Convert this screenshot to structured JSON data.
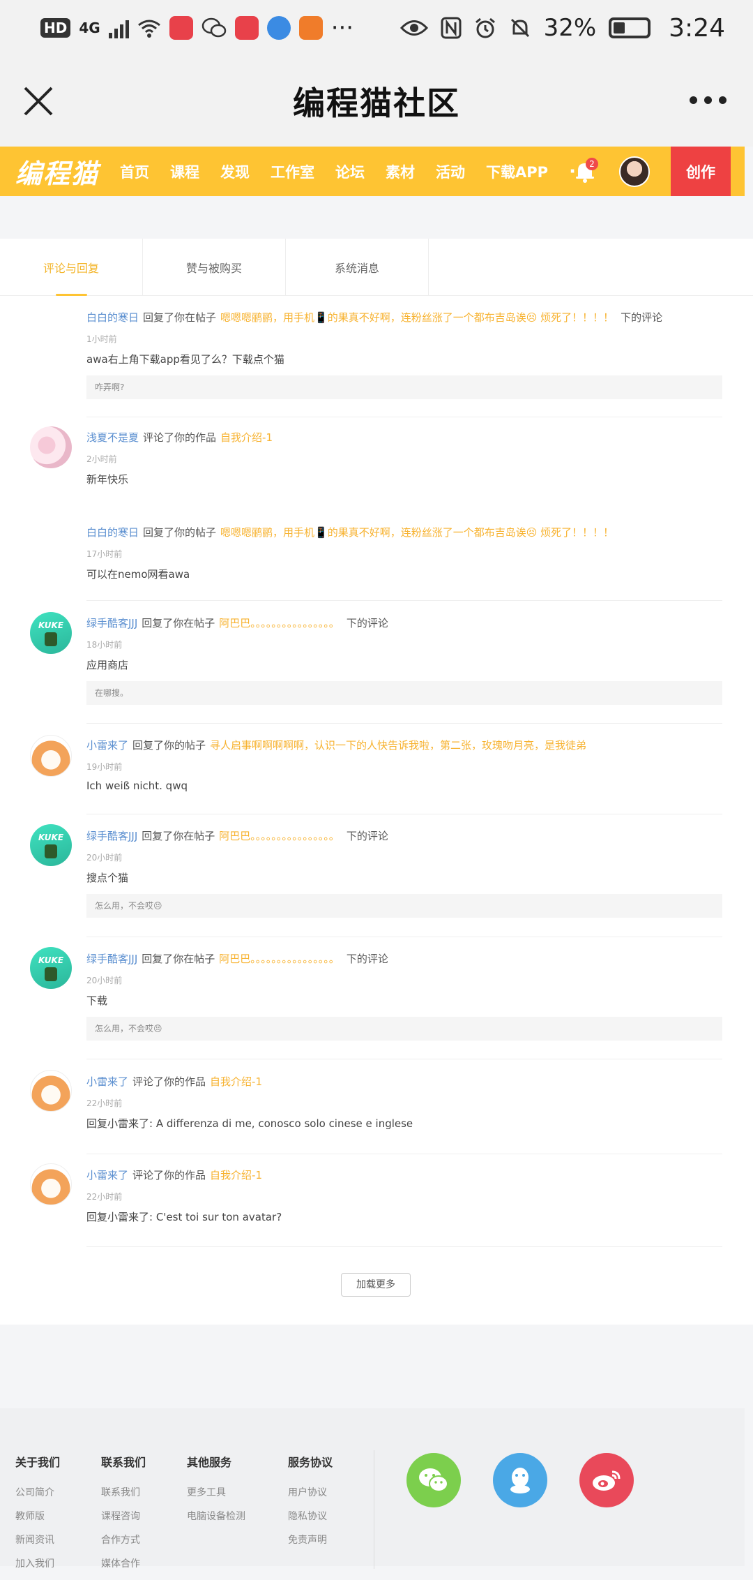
{
  "status_bar": {
    "hd": "HD",
    "net": "4G",
    "more": "···",
    "battery": "32%",
    "time": "3:24"
  },
  "titlebar": {
    "title": "编程猫社区"
  },
  "sitenav": {
    "logo": "编程猫",
    "items": [
      "首页",
      "课程",
      "发现",
      "工作室",
      "论坛",
      "素材",
      "活动",
      "下载APP"
    ],
    "more": "···",
    "notification_count": "2",
    "create_label": "创作"
  },
  "tabs": [
    {
      "label": "评论与回复",
      "active": true
    },
    {
      "label": "赞与被购买",
      "active": false
    },
    {
      "label": "系统消息",
      "active": false
    }
  ],
  "messages": [
    {
      "avatar": "none",
      "user": "白白的寒日",
      "action": "回复了你在帖子",
      "ref": "嗯嗯嗯鹂鹂，用手机📱的果真不好啊，连粉丝涨了一个都布吉岛诶😣 烦死了！！！！",
      "tail": "下的评论",
      "time": "1小时前",
      "body": "awa右上角下载app看见了么？下载点个猫",
      "quote": "咋弄啊?"
    },
    {
      "avatar": "flower",
      "user": "浅夏不是夏",
      "action": "评论了你的作品",
      "ref": "自我介绍-1",
      "tail": "",
      "time": "2小时前",
      "body": "新年快乐",
      "quote": ""
    },
    {
      "avatar": "none",
      "user": "白白的寒日",
      "action": "回复了你的帖子",
      "ref": "嗯嗯嗯鹂鹂，用手机📱的果真不好啊，连粉丝涨了一个都布吉岛诶😣 烦死了！！！！",
      "tail": "",
      "time": "17小时前",
      "body": "可以在nemo网看awa",
      "quote": ""
    },
    {
      "avatar": "kuke",
      "user": "绿手酷客JJJ",
      "action": "回复了你在帖子",
      "ref": "阿巴巴。。。。。。。。。。。。。。。。",
      "tail": "下的评论",
      "time": "18小时前",
      "body": "应用商店",
      "quote": "在哪搜。"
    },
    {
      "avatar": "shiba",
      "user": "小雷来了",
      "action": "回复了你的帖子",
      "ref": "寻人启事啊啊啊啊啊，认识一下的人快告诉我啦，第二张，玫瑰吻月亮，是我徒弟",
      "tail": "",
      "time": "19小时前",
      "body": "Ich weiß nicht. qwq",
      "quote": ""
    },
    {
      "avatar": "kuke",
      "user": "绿手酷客JJJ",
      "action": "回复了你在帖子",
      "ref": "阿巴巴。。。。。。。。。。。。。。。。",
      "tail": "下的评论",
      "time": "20小时前",
      "body": "搜点个猫",
      "quote": "怎么用，不会哎😣"
    },
    {
      "avatar": "kuke",
      "user": "绿手酷客JJJ",
      "action": "回复了你在帖子",
      "ref": "阿巴巴。。。。。。。。。。。。。。。。",
      "tail": "下的评论",
      "time": "20小时前",
      "body": "下载",
      "quote": "怎么用，不会哎😣"
    },
    {
      "avatar": "shiba",
      "user": "小雷来了",
      "action": "评论了你的作品",
      "ref": "自我介绍-1",
      "tail": "",
      "time": "22小时前",
      "body": "回复小雷来了:   A differenza di me, conosco solo cinese e inglese",
      "quote": ""
    },
    {
      "avatar": "shiba",
      "user": "小雷来了",
      "action": "评论了你的作品",
      "ref": "自我介绍-1",
      "tail": "",
      "time": "22小时前",
      "body": "回复小雷来了:   C'est toi sur ton avatar?",
      "quote": ""
    }
  ],
  "load_more": "加载更多",
  "footer": {
    "columns": [
      {
        "heading": "关于我们",
        "links": [
          "公司简介",
          "教师版",
          "新闻资讯",
          "加入我们"
        ]
      },
      {
        "heading": "联系我们",
        "links": [
          "联系我们",
          "课程咨询",
          "合作方式",
          "媒体合作"
        ]
      },
      {
        "heading": "其他服务",
        "links": [
          "更多工具",
          "电脑设备检测"
        ]
      },
      {
        "heading": "服务协议",
        "links": [
          "用户协议",
          "隐私协议",
          "免责声明"
        ]
      }
    ],
    "social": [
      "wechat-icon",
      "qq-icon",
      "weibo-icon"
    ]
  }
}
